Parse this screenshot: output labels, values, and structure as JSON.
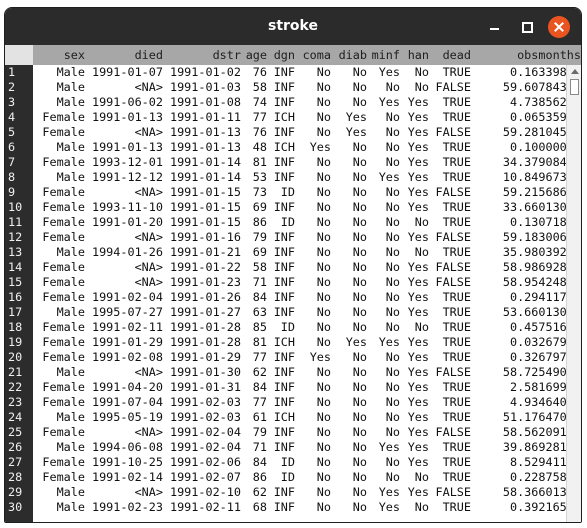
{
  "window": {
    "title": "stroke"
  },
  "table": {
    "columns": [
      "sex",
      "died",
      "dstr",
      "age",
      "dgn",
      "coma",
      "diab",
      "minf",
      "han",
      "dead",
      "obsmonths"
    ],
    "rows": [
      {
        "n": "1",
        "cells": [
          "Male",
          "1991-01-07",
          "1991-01-02",
          "76",
          "INF",
          "No",
          "No",
          "Yes",
          "No",
          "TRUE",
          "0.16339869"
        ]
      },
      {
        "n": "2",
        "cells": [
          "Male",
          "<NA>",
          "1991-01-03",
          "58",
          "INF",
          "No",
          "No",
          "No",
          "No",
          "FALSE",
          "59.60784314"
        ]
      },
      {
        "n": "3",
        "cells": [
          "Male",
          "1991-06-02",
          "1991-01-08",
          "74",
          "INF",
          "No",
          "No",
          "Yes",
          "Yes",
          "TRUE",
          "4.73856209"
        ]
      },
      {
        "n": "4",
        "cells": [
          "Female",
          "1991-01-13",
          "1991-01-11",
          "77",
          "ICH",
          "No",
          "Yes",
          "No",
          "Yes",
          "TRUE",
          "0.06535948"
        ]
      },
      {
        "n": "5",
        "cells": [
          "Female",
          "<NA>",
          "1991-01-13",
          "76",
          "INF",
          "No",
          "Yes",
          "No",
          "Yes",
          "FALSE",
          "59.28104575"
        ]
      },
      {
        "n": "6",
        "cells": [
          "Male",
          "1991-01-13",
          "1991-01-13",
          "48",
          "ICH",
          "Yes",
          "No",
          "No",
          "Yes",
          "TRUE",
          "0.10000000"
        ]
      },
      {
        "n": "7",
        "cells": [
          "Female",
          "1993-12-01",
          "1991-01-14",
          "81",
          "INF",
          "No",
          "No",
          "No",
          "Yes",
          "TRUE",
          "34.37908497"
        ]
      },
      {
        "n": "8",
        "cells": [
          "Male",
          "1991-12-12",
          "1991-01-14",
          "53",
          "INF",
          "No",
          "No",
          "Yes",
          "Yes",
          "TRUE",
          "10.84967320"
        ]
      },
      {
        "n": "9",
        "cells": [
          "Female",
          "<NA>",
          "1991-01-15",
          "73",
          "ID",
          "No",
          "No",
          "No",
          "Yes",
          "FALSE",
          "59.21568627"
        ]
      },
      {
        "n": "10",
        "cells": [
          "Female",
          "1993-11-10",
          "1991-01-15",
          "69",
          "INF",
          "No",
          "No",
          "No",
          "Yes",
          "TRUE",
          "33.66013072"
        ]
      },
      {
        "n": "11",
        "cells": [
          "Female",
          "1991-01-20",
          "1991-01-15",
          "86",
          "ID",
          "No",
          "No",
          "No",
          "No",
          "TRUE",
          "0.13071895"
        ]
      },
      {
        "n": "12",
        "cells": [
          "Female",
          "<NA>",
          "1991-01-16",
          "79",
          "INF",
          "No",
          "No",
          "No",
          "Yes",
          "FALSE",
          "59.18300654"
        ]
      },
      {
        "n": "13",
        "cells": [
          "Male",
          "1994-01-26",
          "1991-01-21",
          "69",
          "INF",
          "No",
          "No",
          "No",
          "No",
          "TRUE",
          "35.98039216"
        ]
      },
      {
        "n": "14",
        "cells": [
          "Female",
          "<NA>",
          "1991-01-22",
          "58",
          "INF",
          "No",
          "No",
          "No",
          "Yes",
          "FALSE",
          "58.98692810"
        ]
      },
      {
        "n": "15",
        "cells": [
          "Female",
          "<NA>",
          "1991-01-23",
          "71",
          "INF",
          "No",
          "No",
          "No",
          "Yes",
          "FALSE",
          "58.95424837"
        ]
      },
      {
        "n": "16",
        "cells": [
          "Female",
          "1991-02-04",
          "1991-01-26",
          "84",
          "INF",
          "No",
          "No",
          "No",
          "Yes",
          "TRUE",
          "0.29411765"
        ]
      },
      {
        "n": "17",
        "cells": [
          "Male",
          "1995-07-27",
          "1991-01-27",
          "63",
          "INF",
          "No",
          "No",
          "No",
          "Yes",
          "TRUE",
          "53.66013072"
        ]
      },
      {
        "n": "18",
        "cells": [
          "Female",
          "1991-02-11",
          "1991-01-28",
          "85",
          "ID",
          "No",
          "No",
          "No",
          "No",
          "TRUE",
          "0.45751634"
        ]
      },
      {
        "n": "19",
        "cells": [
          "Female",
          "1991-01-29",
          "1991-01-28",
          "81",
          "ICH",
          "No",
          "Yes",
          "Yes",
          "Yes",
          "TRUE",
          "0.03267974"
        ]
      },
      {
        "n": "20",
        "cells": [
          "Female",
          "1991-02-08",
          "1991-01-29",
          "77",
          "INF",
          "Yes",
          "No",
          "No",
          "Yes",
          "TRUE",
          "0.32679739"
        ]
      },
      {
        "n": "21",
        "cells": [
          "Male",
          "<NA>",
          "1991-01-30",
          "62",
          "INF",
          "No",
          "No",
          "No",
          "Yes",
          "FALSE",
          "58.72549020"
        ]
      },
      {
        "n": "22",
        "cells": [
          "Female",
          "1991-04-20",
          "1991-01-31",
          "84",
          "INF",
          "No",
          "No",
          "No",
          "Yes",
          "TRUE",
          "2.58169935"
        ]
      },
      {
        "n": "23",
        "cells": [
          "Female",
          "1991-07-04",
          "1991-02-03",
          "77",
          "INF",
          "No",
          "No",
          "No",
          "Yes",
          "TRUE",
          "4.93464052"
        ]
      },
      {
        "n": "24",
        "cells": [
          "Male",
          "1995-05-19",
          "1991-02-03",
          "61",
          "ICH",
          "No",
          "No",
          "No",
          "Yes",
          "TRUE",
          "51.17647059"
        ]
      },
      {
        "n": "25",
        "cells": [
          "Female",
          "<NA>",
          "1991-02-04",
          "79",
          "INF",
          "No",
          "No",
          "No",
          "Yes",
          "FALSE",
          "58.56209150"
        ]
      },
      {
        "n": "26",
        "cells": [
          "Male",
          "1994-06-08",
          "1991-02-04",
          "71",
          "INF",
          "No",
          "No",
          "Yes",
          "Yes",
          "TRUE",
          "39.86928105"
        ]
      },
      {
        "n": "27",
        "cells": [
          "Female",
          "1991-10-25",
          "1991-02-06",
          "84",
          "ID",
          "No",
          "No",
          "No",
          "Yes",
          "TRUE",
          "8.52941176"
        ]
      },
      {
        "n": "28",
        "cells": [
          "Female",
          "1991-02-14",
          "1991-02-07",
          "86",
          "ID",
          "No",
          "No",
          "No",
          "No",
          "TRUE",
          "0.22875817"
        ]
      },
      {
        "n": "29",
        "cells": [
          "Male",
          "<NA>",
          "1991-02-10",
          "62",
          "INF",
          "No",
          "No",
          "Yes",
          "Yes",
          "FALSE",
          "58.36601307"
        ]
      },
      {
        "n": "30",
        "cells": [
          "Male",
          "1991-02-23",
          "1991-02-11",
          "68",
          "INF",
          "No",
          "No",
          "Yes",
          "No",
          "TRUE",
          "0.39216586"
        ]
      }
    ]
  },
  "icons": {
    "minimize": "minimize-icon",
    "maximize": "maximize-icon",
    "close": "close-icon",
    "scroll_up": "scroll-up-arrow-icon"
  },
  "colors": {
    "titlebar": "#2b2b2b",
    "close_button": "#e95420",
    "header_bg": "#a7a7a7",
    "rownum_bg": "#2c2c2c"
  }
}
